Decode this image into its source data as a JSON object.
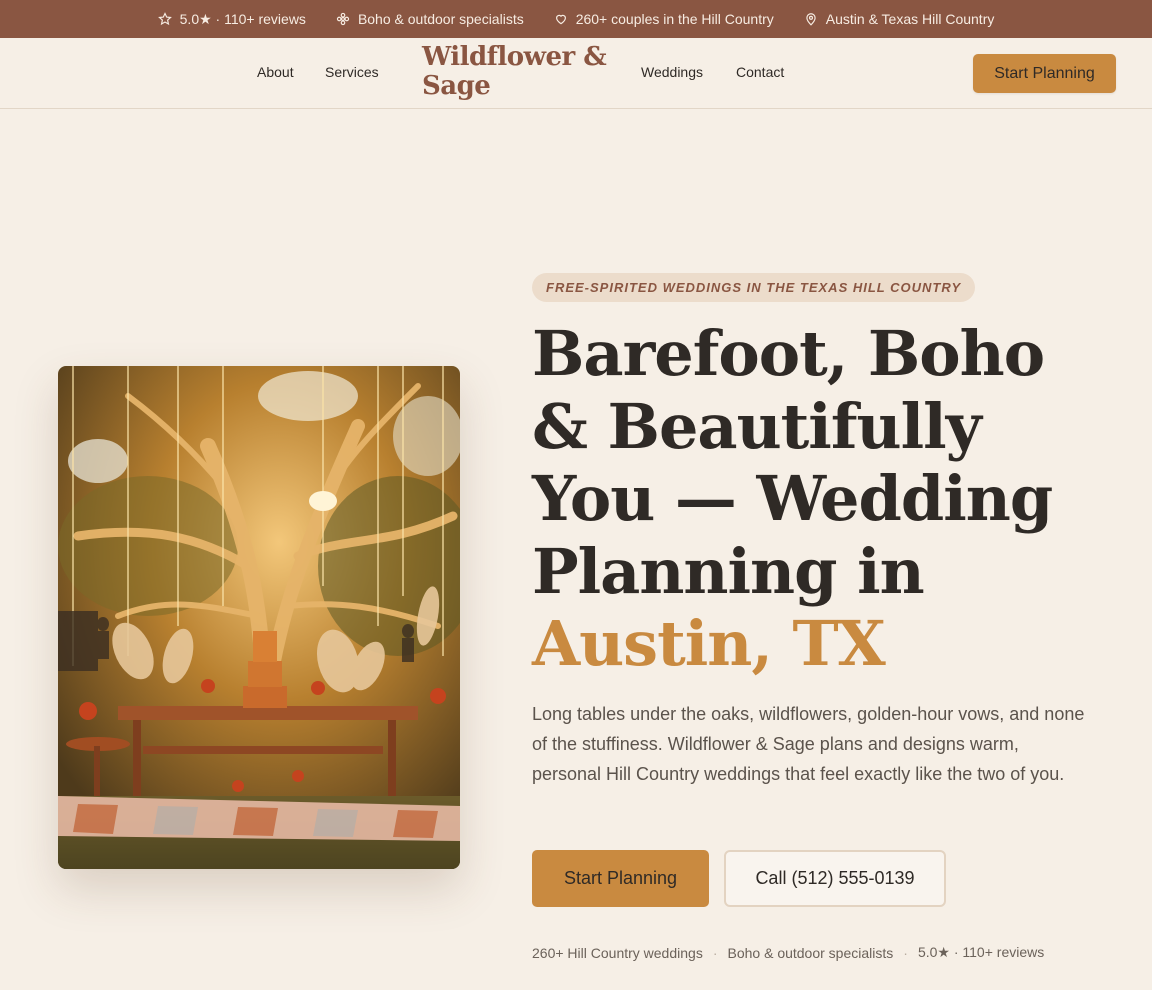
{
  "topbar": {
    "items": [
      {
        "icon": "star-icon",
        "text": "5.0★ · 110+ reviews"
      },
      {
        "icon": "flower-icon",
        "text": "Boho & outdoor specialists"
      },
      {
        "icon": "heart-icon",
        "text": "260+ couples in the Hill Country"
      },
      {
        "icon": "map-pin-icon",
        "text": "Austin & Texas Hill Country"
      }
    ]
  },
  "nav": {
    "links": [
      "About",
      "Services",
      "Weddings",
      "Contact"
    ],
    "logo": "Wildflower & Sage",
    "cta": "Start Planning"
  },
  "hero": {
    "eyebrow": "FREE-SPIRITED WEDDINGS IN THE TEXAS HILL COUNTRY",
    "headline": "Barefoot, Boho & Beautifully You — Wedding Planning in",
    "headline_accent": "Austin, TX",
    "lede": "Long tables under the oaks, wildflowers, golden-hour vows, and none of the stuffiness. Wildflower & Sage plans and designs warm, personal Hill Country weddings that feel exactly like the two of you.",
    "primary_cta": "Start Planning",
    "secondary_cta": "Call (512) 555-0139",
    "proof": [
      "260+ Hill Country weddings",
      "Boho & outdoor specialists",
      "5.0★ · 110+ reviews"
    ],
    "proof_separator": "·"
  },
  "colors": {
    "topbar_bg": "#8a5642",
    "page_bg": "#f6efe6",
    "accent": "#c98a40",
    "ink": "#2f2a26",
    "logo": "#8a5642"
  }
}
